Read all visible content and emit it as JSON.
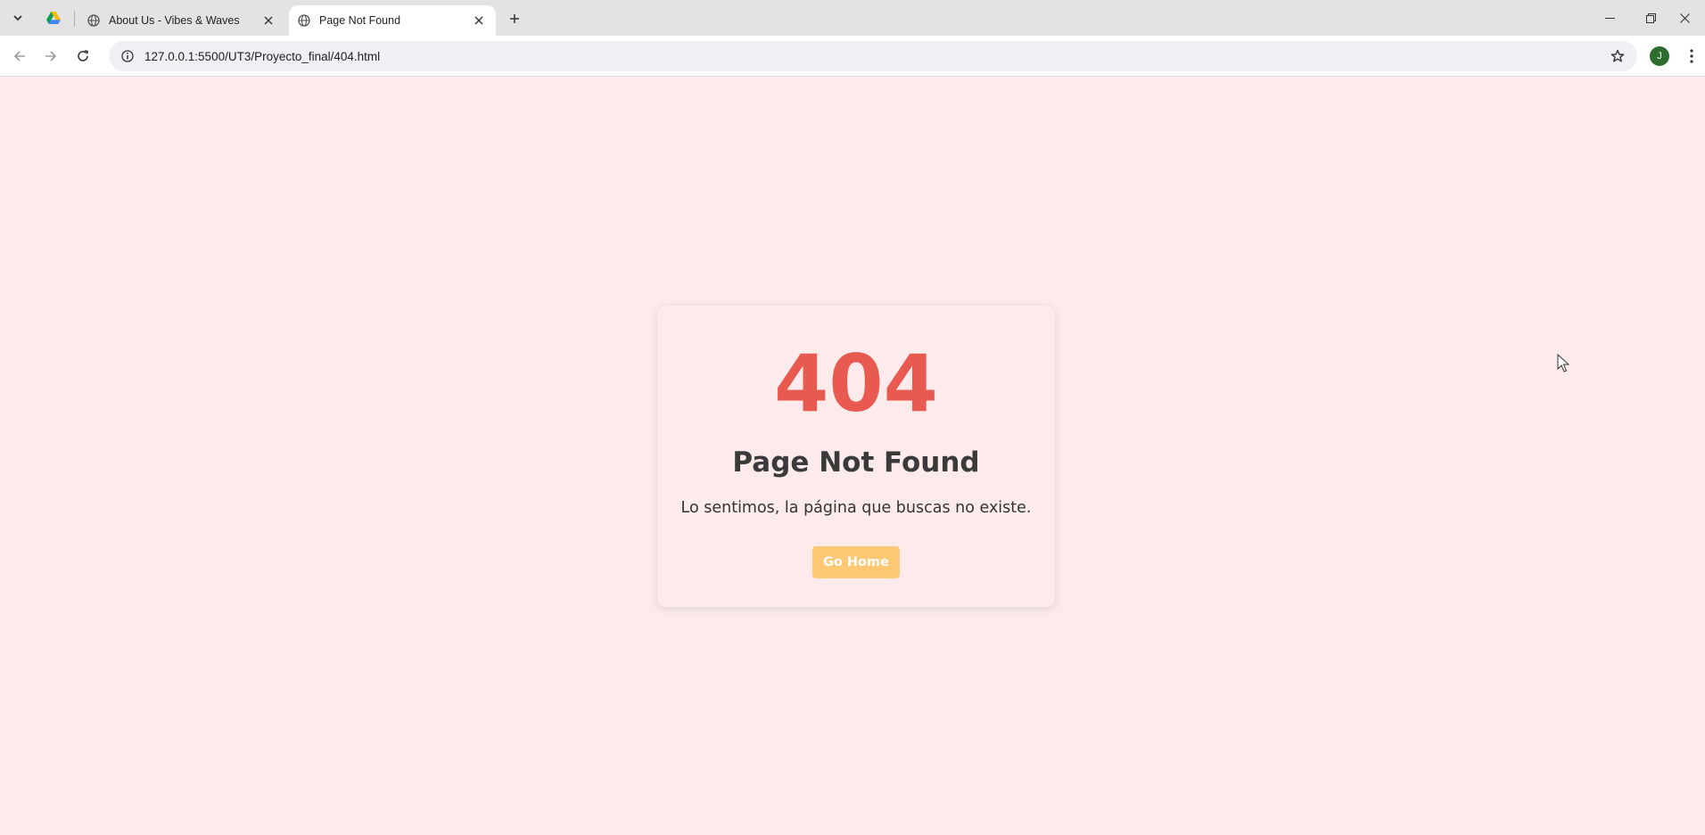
{
  "browser": {
    "tabs": [
      {
        "title": "About Us - Vibes & Waves",
        "active": false
      },
      {
        "title": "Page Not Found",
        "active": true
      }
    ],
    "url": "127.0.0.1:5500/UT3/Proyecto_final/404.html",
    "profile_initial": "J"
  },
  "page": {
    "error_code": "404",
    "heading": "Page Not Found",
    "message": "Lo sentimos, la página que buscas no existe.",
    "button_label": "Go Home"
  },
  "colors": {
    "background": "#fcebea",
    "error_code": "#e85a4f",
    "button": "#ffc874",
    "heading": "#3a3a3a"
  }
}
